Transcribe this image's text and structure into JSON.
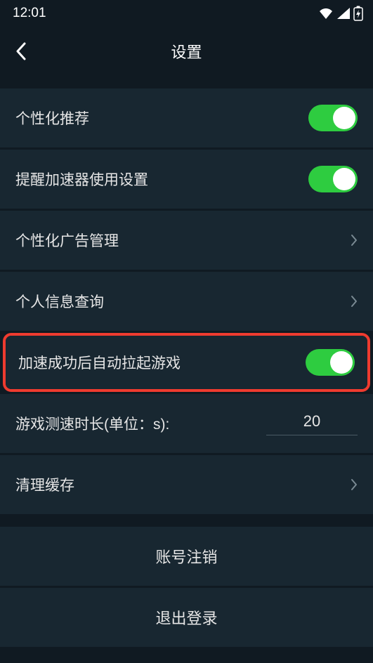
{
  "status": {
    "time": "12:01"
  },
  "nav": {
    "title": "设置"
  },
  "rows": {
    "personalized_recommend": "个性化推荐",
    "accelerator_reminder": "提醒加速器使用设置",
    "personalized_ads": "个性化广告管理",
    "personal_info_query": "个人信息查询",
    "auto_launch_game": "加速成功后自动拉起游戏",
    "speed_test_duration_label": "游戏测速时长(单位：s):",
    "speed_test_duration_value": "20",
    "clear_cache": "清理缓存"
  },
  "actions": {
    "delete_account": "账号注销",
    "logout": "退出登录"
  }
}
